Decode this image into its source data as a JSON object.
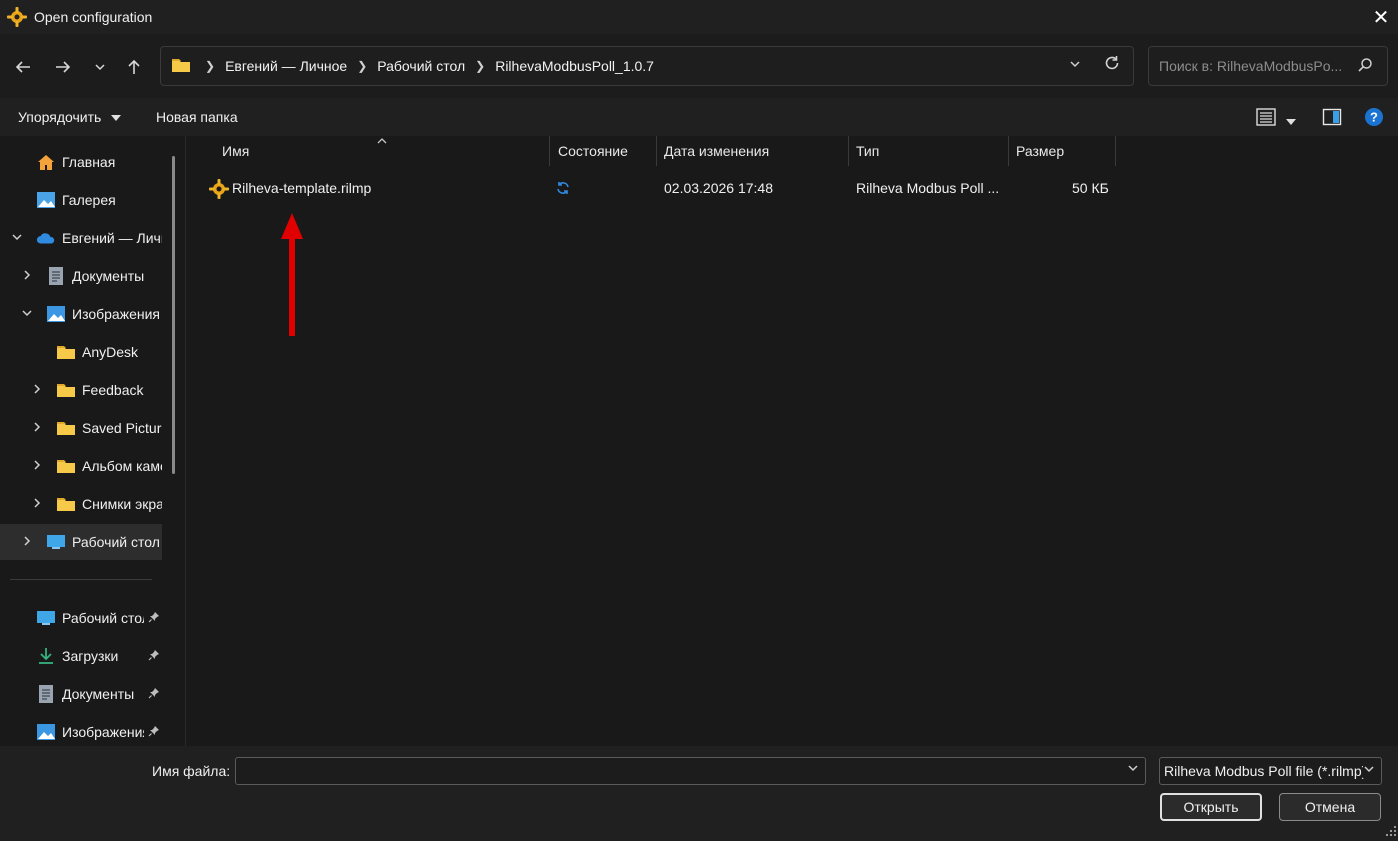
{
  "window": {
    "title": "Open configuration",
    "close_glyph": "✕"
  },
  "address": {
    "breadcrumbs": [
      "Евгений — Личное",
      "Рабочий стол",
      "RilhevaModbusPoll_1.0.7"
    ]
  },
  "search": {
    "placeholder": "Поиск в: RilhevaModbusPo..."
  },
  "commandbar": {
    "organize_label": "Упорядочить",
    "new_folder_label": "Новая папка"
  },
  "sidebar": {
    "items": [
      {
        "label": "Главная",
        "icon": "home-icon"
      },
      {
        "label": "Галерея",
        "icon": "gallery-icon"
      },
      {
        "label": "Евгений — Личное",
        "icon": "onedrive-icon",
        "expanded": true
      },
      {
        "label": "Документы",
        "icon": "documents-icon"
      },
      {
        "label": "Изображения",
        "icon": "pictures-icon",
        "expanded": true
      },
      {
        "label": "AnyDesk",
        "icon": "folder-icon"
      },
      {
        "label": "Feedback",
        "icon": "folder-icon"
      },
      {
        "label": "Saved Pictures",
        "icon": "folder-icon"
      },
      {
        "label": "Альбом камеры",
        "icon": "folder-icon"
      },
      {
        "label": "Снимки экрана",
        "icon": "folder-icon"
      },
      {
        "label": "Рабочий стол",
        "icon": "desktop-icon",
        "selected": true
      }
    ],
    "quick_access": [
      {
        "label": "Рабочий стол",
        "icon": "desktop-icon"
      },
      {
        "label": "Загрузки",
        "icon": "downloads-icon"
      },
      {
        "label": "Документы",
        "icon": "documents-icon"
      },
      {
        "label": "Изображения",
        "icon": "pictures-icon"
      }
    ]
  },
  "files": {
    "columns": [
      "Имя",
      "Состояние",
      "Дата изменения",
      "Тип",
      "Размер"
    ],
    "rows": [
      {
        "name": "Rilheva-template.rilmp",
        "status_icon": "sync-icon",
        "date": "02.03.2026 17:48",
        "type": "Rilheva Modbus Poll ...",
        "size": "50 КБ"
      }
    ]
  },
  "bottom": {
    "filename_label": "Имя файла:",
    "filename_value": "",
    "filter_value": "Rilheva Modbus Poll file (*.rilmp)",
    "open_label": "Открыть",
    "cancel_label": "Отмена"
  },
  "colors": {
    "accent": "#0f6cbd",
    "folder": "#f7c948",
    "annotation_arrow": "#e00000"
  }
}
